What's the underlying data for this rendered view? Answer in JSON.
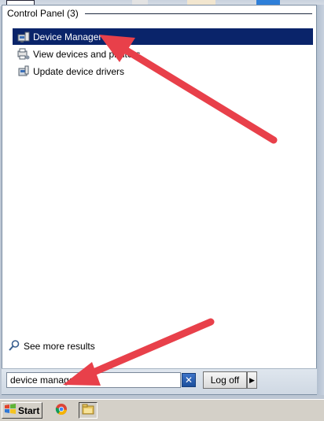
{
  "start_menu": {
    "group_header": "Control Panel (3)",
    "results": [
      {
        "label": "Device Manager",
        "icon": "device-manager-icon",
        "selected": true
      },
      {
        "label": "View devices and printers",
        "icon": "devices-printers-icon",
        "selected": false
      },
      {
        "label": "Update device drivers",
        "icon": "device-drivers-icon",
        "selected": false
      }
    ],
    "see_more_label": "See more results",
    "search_value": "device manager",
    "clear_button_label": "✕",
    "logoff_label": "Log off",
    "logoff_arrow_label": "▶"
  },
  "taskbar": {
    "start_label": "Start",
    "pinned": [
      "chrome-icon",
      "file-explorer-icon"
    ]
  },
  "colors": {
    "selection": "#0a246a",
    "arrow": "#e8404a"
  }
}
